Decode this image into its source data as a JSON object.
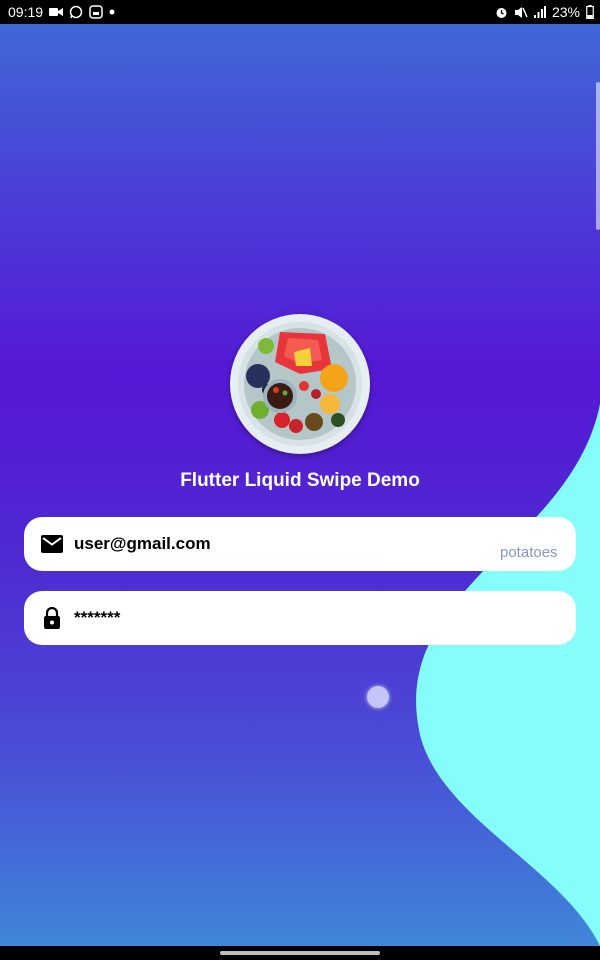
{
  "status_bar": {
    "time": "09:19",
    "battery_percent": "23%",
    "left_icons": [
      "video-camera-icon",
      "whatsapp-icon",
      "screen-record-icon",
      "notification-dot-icon"
    ],
    "right_icons": [
      "alarm-icon",
      "mute-icon",
      "signal-icon",
      "battery-icon"
    ]
  },
  "app": {
    "title": "Flutter Liquid Swipe Demo",
    "email_value": "user@gmail.com",
    "password_value": "*******",
    "next_page_peek_text": "potatoes",
    "colors": {
      "gradient_top": "#4068d6",
      "gradient_middle": "#5518d4",
      "gradient_bottom": "#3f86d8",
      "liquid_page": "#84fdfb",
      "field_background": "#ffffff",
      "title_text": "#ffffff"
    }
  }
}
